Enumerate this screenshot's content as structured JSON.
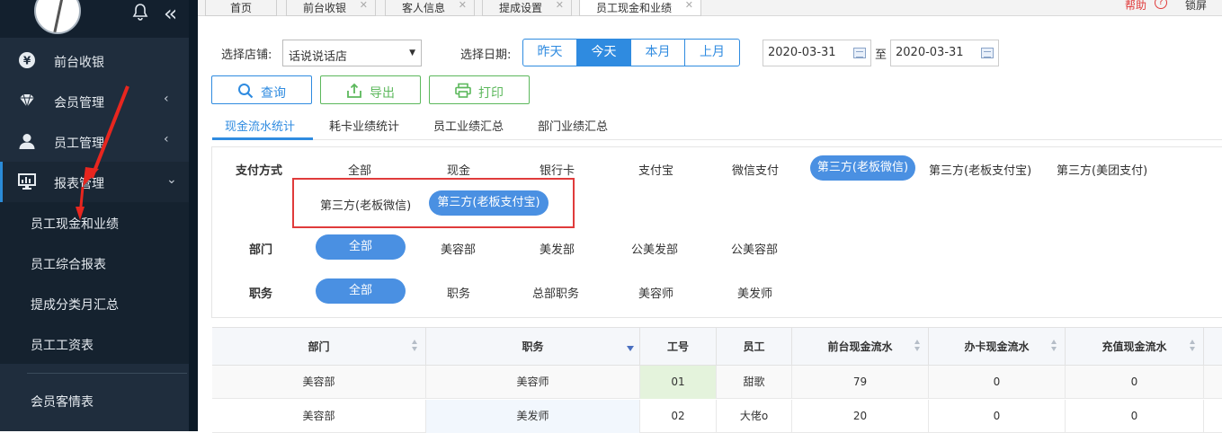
{
  "sidebar": {
    "menu": [
      {
        "label": "前台收银",
        "icon": "yen-icon"
      },
      {
        "label": "会员管理",
        "icon": "diamond-icon"
      },
      {
        "label": "员工管理",
        "icon": "user-icon"
      },
      {
        "label": "报表管理",
        "icon": "monitor-icon"
      }
    ],
    "sub_items": [
      "员工现金和业绩",
      "员工综合报表",
      "提成分类月汇总",
      "员工工资表"
    ],
    "bottom_item": "会员客情表"
  },
  "tabs": [
    {
      "label": "首页"
    },
    {
      "label": "前台收银"
    },
    {
      "label": "客人信息"
    },
    {
      "label": "提成设置"
    },
    {
      "label": "员工现金和业绩"
    }
  ],
  "header_links": {
    "help": "帮助",
    "lock": "锁屏"
  },
  "filters": {
    "store_label": "选择店铺:",
    "store_value": "话说说话店",
    "date_label": "选择日期:",
    "date_options": [
      "昨天",
      "今天",
      "本月",
      "上月"
    ],
    "date_selected": "今天",
    "date_from": "2020-03-31",
    "date_to_sep": "至",
    "date_to": "2020-03-31"
  },
  "buttons": {
    "query": "查询",
    "export": "导出",
    "print": "打印"
  },
  "subtabs": [
    "现金流水统计",
    "耗卡业绩统计",
    "员工业绩汇总",
    "部门业绩汇总"
  ],
  "payment": {
    "label": "支付方式",
    "options": [
      "全部",
      "现金",
      "银行卡",
      "支付宝",
      "微信支付",
      "第三方(老板微信)",
      "第三方(老板支付宝)",
      "第三方(美团支付)"
    ],
    "options_row2": [
      "第三方(老板微信)",
      "第三方(老板支付宝)"
    ]
  },
  "department": {
    "label": "部门",
    "options": [
      "全部",
      "美容部",
      "美发部",
      "公美发部",
      "公美容部"
    ]
  },
  "position": {
    "label": "职务",
    "options": [
      "全部",
      "职务",
      "总部职务",
      "美容师",
      "美发师"
    ]
  },
  "table": {
    "headers": [
      "部门",
      "职务",
      "工号",
      "员工",
      "前台现金流水",
      "办卡现金流水",
      "充值现金流水"
    ],
    "rows": [
      [
        "美容部",
        "美容师",
        "01",
        "甜歌",
        "79",
        "0",
        "0"
      ],
      [
        "美容部",
        "美发师",
        "02",
        "大佬o",
        "20",
        "0",
        "0"
      ]
    ]
  },
  "colors": {
    "accent": "#2f8be0",
    "sidebar": "#1f2d3d",
    "green": "#5cb85c",
    "annotation": "#e03b3b"
  }
}
